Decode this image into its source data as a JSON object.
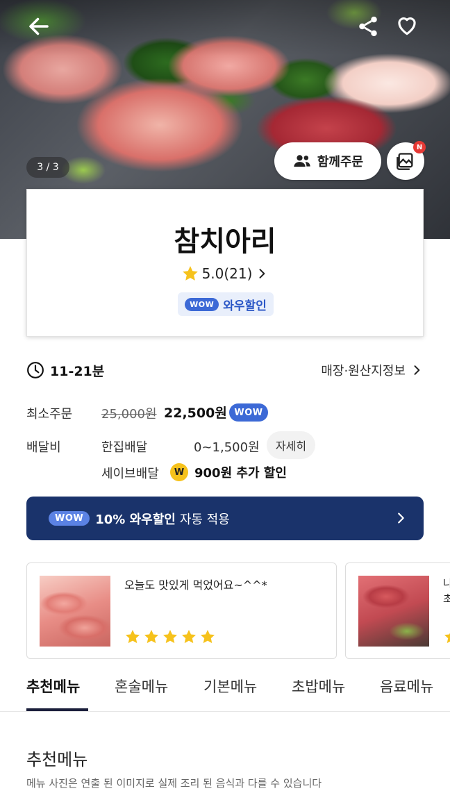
{
  "hero": {
    "image_counter": "3 / 3",
    "group_order_label": "함께주문",
    "photo_new_badge": "N"
  },
  "store": {
    "name": "참치아리",
    "rating": "5.0(21)",
    "wow_pill": "WOW",
    "wow_label": "와우할인"
  },
  "delivery": {
    "time": "11-21분",
    "store_info_link": "매장·원산지정보",
    "min_order_label": "최소주문",
    "min_order_original": "25,000원",
    "min_order_price": "22,500원",
    "min_order_wow": "WOW",
    "fee_label": "배달비",
    "fee_type": "한집배달",
    "fee_range": "0~1,500원",
    "detail_button": "자세히",
    "save_type": "세이브배달",
    "save_coin": "W",
    "save_discount": "900원 추가 할인"
  },
  "wow_banner": {
    "pill": "WOW",
    "bold_text": "10% 와우할인",
    "normal_text": "자동 적용"
  },
  "reviews": [
    {
      "text": "오늘도 맛있게 먹었어요~^^*",
      "stars": 5
    },
    {
      "text_line1": "나",
      "text_line2": "초",
      "stars": 1
    }
  ],
  "tabs": [
    "추천메뉴",
    "혼술메뉴",
    "기본메뉴",
    "초밥메뉴",
    "음료메뉴"
  ],
  "section": {
    "title": "추천메뉴",
    "description": "메뉴 사진은 연출 된 이미지로 실제 조리 된 음식과 다를 수 있습니다"
  },
  "colors": {
    "wow_blue": "#3c69d6",
    "banner_navy": "#1a336b",
    "star_yellow": "#f6c21c"
  }
}
